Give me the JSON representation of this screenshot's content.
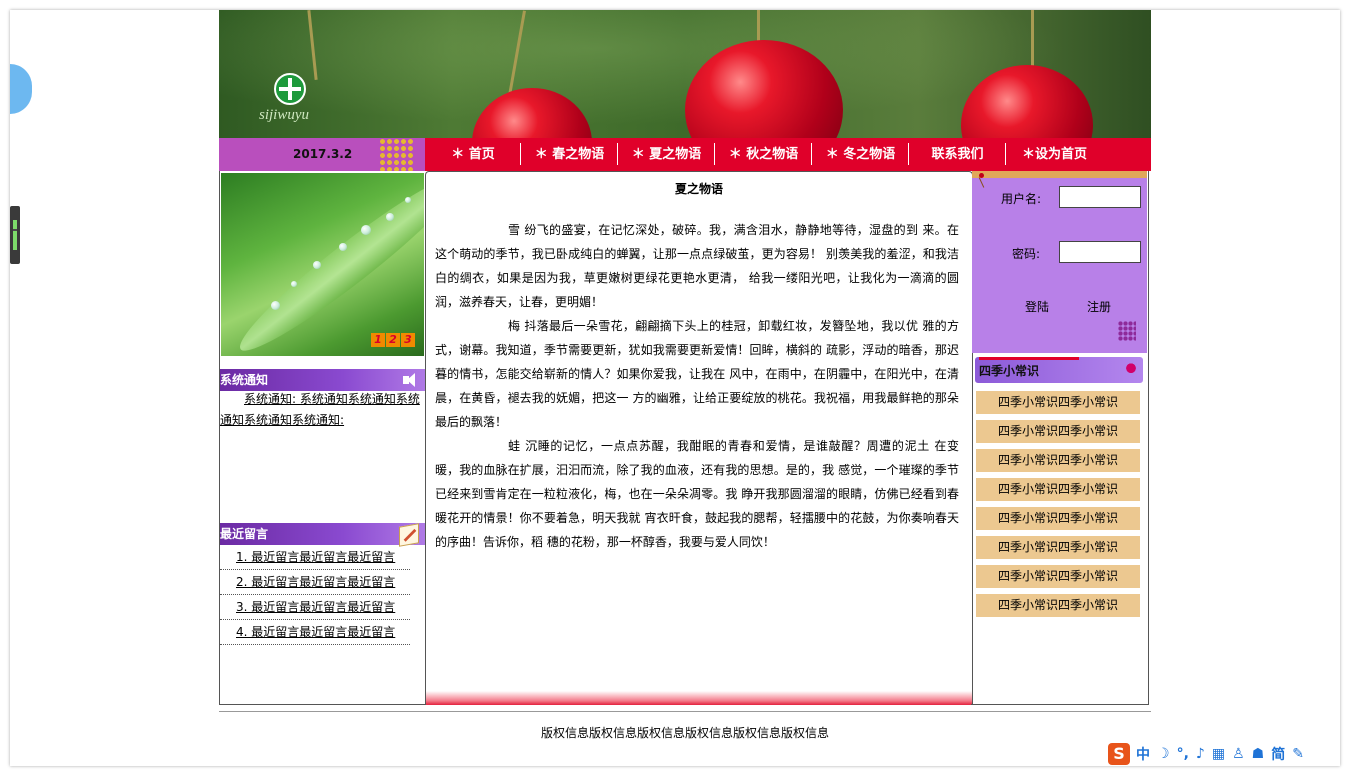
{
  "banner": {
    "logo_text": "sijiwuyu"
  },
  "nav": {
    "date": "2017.3.2",
    "items": [
      "＊ 首页",
      "＊ 春之物语",
      "＊ 夏之物语",
      "＊ 秋之物语",
      "＊ 冬之物语",
      "联系我们",
      "＊设为首页"
    ]
  },
  "hero": {
    "pager": [
      "1",
      "2",
      "3"
    ]
  },
  "notice": {
    "title": "系统通知",
    "text": "系统通知: 系统通知系统通知系统通知系统通知系统通知:"
  },
  "messages": {
    "title": "最近留言",
    "items": [
      "1. 最近留言最近留言最近留言",
      "2. 最近留言最近留言最近留言",
      "3. 最近留言最近留言最近留言",
      "4. 最近留言最近留言最近留言"
    ]
  },
  "article": {
    "title": "夏之物语",
    "paragraphs": [
      "雪 纷飞的盛宴，在记忆深处，破碎。我，满含泪水，静静地等待，湿盘的到 来。在这个萌动的季节，我已卧成纯白的蝉翼，让那一点点绿破茧，更为容易！ 别羡美我的羞涩，和我洁白的绸衣，如果是因为我，草更嫩树更绿花更艳水更清， 给我一缕阳光吧，让我化为一滴滴的圆润，滋养春天，让春，更明媚！",
      "梅 抖落最后一朵雪花，翩翩摘下头上的桂冠，卸载红妆，发簪坠地，我以优 雅的方式，谢幕。我知道，季节需要更新，犹如我需要更新爱情！回眸，横斜的 疏影，浮动的暗香，那迟暮的情书，怎能交给崭新的情人？如果你爱我，让我在 风中，在雨中，在阴霾中，在阳光中，在清晨，在黄昏，褪去我的妩媚，把这一 方的幽雅，让给正要绽放的桃花。我祝福，用我最鲜艳的那朵最后的飘落！",
      "蛙 沉睡的记忆，一点点苏醒，我酣眠的青春和爱情，是谁敲醒？周遭的泥土 在变暖，我的血脉在扩展，汩汩而流，除了我的血液，还有我的思想。是的，我 感觉，一个璀璨的季节已经来到雪肯定在一粒粒液化，梅，也在一朵朵凋零。我 睁开我那圆溜溜的眼睛，仿佛已经看到春暖花开的情景！你不要着急，明天我就 宵衣旰食，鼓起我的腮帮，轻擂腰中的花鼓，为你奏响春天的序曲！告诉你，稻 穗的花粉，那一杯醇香，我要与爱人同饮！"
    ]
  },
  "login": {
    "username_label": "用户名:",
    "password_label": "密码:",
    "username_value": "",
    "password_value": "",
    "login_label": "登陆",
    "register_label": "注册"
  },
  "tips": {
    "title": "四季小常识",
    "items": [
      "四季小常识四季小常识",
      "四季小常识四季小常识",
      "四季小常识四季小常识",
      "四季小常识四季小常识",
      "四季小常识四季小常识",
      "四季小常识四季小常识",
      "四季小常识四季小常识",
      "四季小常识四季小常识"
    ]
  },
  "footer": {
    "text": "版权信息版权信息版权信息版权信息版权信息版权信息"
  },
  "ime": {
    "logo": "S",
    "items": [
      "中",
      "☽",
      "°,",
      "♪",
      "▦",
      "♙",
      "☗",
      "简",
      "✎"
    ]
  }
}
